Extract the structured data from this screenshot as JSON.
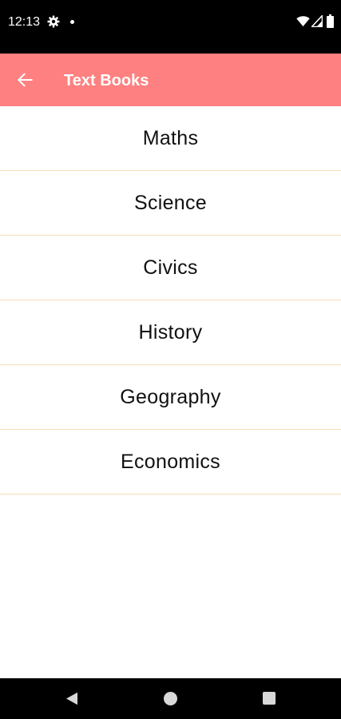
{
  "status_bar": {
    "time": "12:13",
    "icons": [
      "gear-icon",
      "notification-dot-icon",
      "wifi-icon",
      "signal-icon",
      "battery-icon"
    ]
  },
  "app_bar": {
    "title": "Text Books",
    "back_icon": "arrow-left-icon",
    "background_color": "#ff8080"
  },
  "books": [
    {
      "label": "Maths"
    },
    {
      "label": "Science"
    },
    {
      "label": "Civics"
    },
    {
      "label": "History"
    },
    {
      "label": "Geography"
    },
    {
      "label": "Economics"
    }
  ],
  "nav_bar": {
    "icons": [
      "back-triangle-icon",
      "home-circle-icon",
      "recents-square-icon"
    ]
  },
  "colors": {
    "divider": "#f7dfb6",
    "status_bar": "#000000",
    "nav_bar": "#000000"
  }
}
